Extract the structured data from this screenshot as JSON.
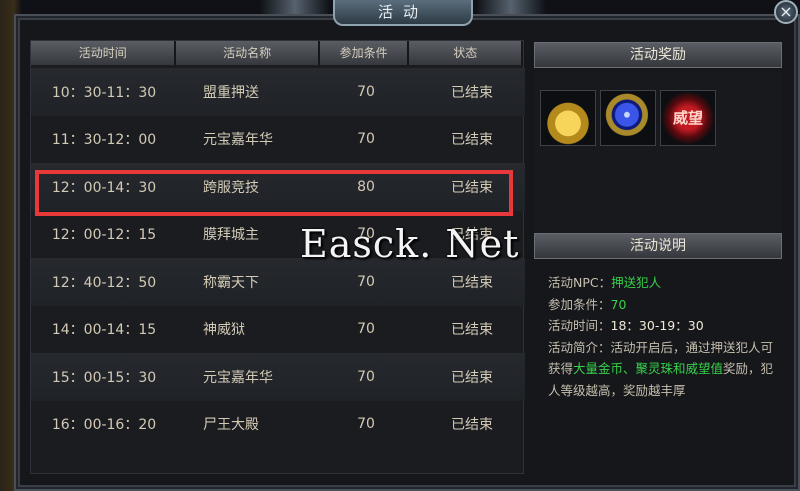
{
  "window": {
    "title": "活动",
    "close_label": "×"
  },
  "table": {
    "headers": [
      "活动时间",
      "活动名称",
      "参加条件",
      "状态"
    ],
    "rows": [
      {
        "time": "10：30-11：30",
        "name": "盟重押送",
        "condition": "70",
        "status": "已结束"
      },
      {
        "time": "11：30-12：00",
        "name": "元宝嘉年华",
        "condition": "70",
        "status": "已结束"
      },
      {
        "time": "12：00-14：30",
        "name": "跨服竞技",
        "condition": "80",
        "status": "已结束"
      },
      {
        "time": "12：00-12：15",
        "name": "膜拜城主",
        "condition": "70",
        "status": "已结束"
      },
      {
        "time": "12：40-12：50",
        "name": "称霸天下",
        "condition": "70",
        "status": "已结束"
      },
      {
        "time": "14：00-14：15",
        "name": "神威狱",
        "condition": "70",
        "status": "已结束"
      },
      {
        "time": "15：00-15：30",
        "name": "元宝嘉年华",
        "condition": "70",
        "status": "已结束"
      },
      {
        "time": "16：00-16：20",
        "name": "尸王大殿",
        "condition": "70",
        "status": "已结束"
      }
    ]
  },
  "watermark": "Easck. Net",
  "rewards": {
    "title": "活动奖励",
    "items": [
      {
        "icon": "gold-coins-icon"
      },
      {
        "icon": "spirit-orb-icon"
      },
      {
        "icon": "prestige-icon",
        "text": "威望"
      }
    ]
  },
  "details": {
    "title": "活动说明",
    "npc_label": "活动NPC：",
    "npc_value": "押送犯人",
    "cond_label": "参加条件：",
    "cond_value": "70",
    "time_label": "活动时间：",
    "time_value": "18：30-19：30",
    "intro_label": "活动简介：",
    "intro_1": "活动开启后，通过押送犯人可获得",
    "intro_hl": "大量金币、聚灵珠和威望值",
    "intro_2": "奖励，犯人等级越高，奖励越丰厚"
  },
  "colors": {
    "highlight_border": "#e8383a",
    "accent_green": "#37d14a"
  }
}
